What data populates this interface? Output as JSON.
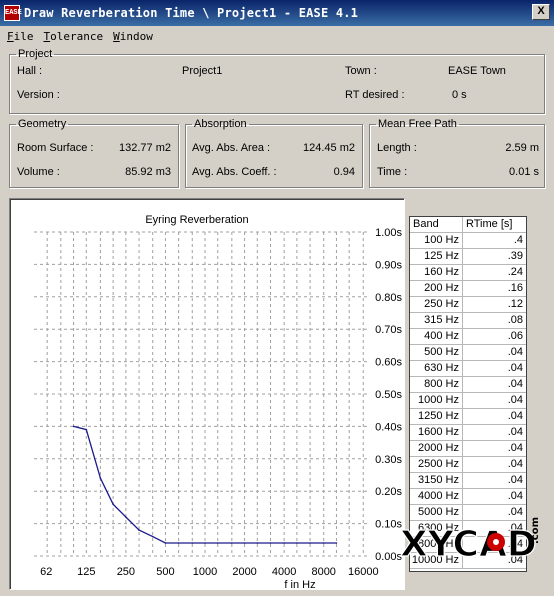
{
  "window": {
    "title": "Draw Reverberation Time \\ Project1 - EASE 4.1",
    "app_icon_text": "EASE",
    "close_label": "X"
  },
  "menu": [
    {
      "label": "File",
      "accel": "F",
      "rest": "ile"
    },
    {
      "label": "Tolerance",
      "accel": "T",
      "rest": "olerance"
    },
    {
      "label": "Window",
      "accel": "W",
      "rest": "indow"
    }
  ],
  "project": {
    "legend": "Project",
    "hall_label": "Hall :",
    "hall_value": "Project1",
    "town_label": "Town :",
    "town_value": "EASE Town",
    "version_label": "Version :",
    "rt_desired_label": "RT desired :",
    "rt_desired_value": "0 s"
  },
  "geometry": {
    "legend": "Geometry",
    "surface_label": "Room Surface :",
    "surface_value": "132.77 m2",
    "volume_label": "Volume :",
    "volume_value": "85.92 m3"
  },
  "absorption": {
    "legend": "Absorption",
    "area_label": "Avg. Abs. Area :",
    "area_value": "124.45 m2",
    "coeff_label": "Avg. Abs. Coeff. :",
    "coeff_value": "0.94"
  },
  "mean_free_path": {
    "legend": "Mean Free Path",
    "length_label": "Length :",
    "length_value": "2.59 m",
    "time_label": "Time :",
    "time_value": "0.01 s"
  },
  "chart_data": {
    "type": "line",
    "title": "Eyring Reverberation",
    "xlabel": "f in Hz",
    "ylabel": "",
    "x_scale": "log",
    "x_ticks": [
      "62",
      "125",
      "250",
      "500",
      "1000",
      "2000",
      "4000",
      "8000",
      "16000"
    ],
    "y_ticks": [
      "0.00s",
      "0.10s",
      "0.20s",
      "0.30s",
      "0.40s",
      "0.50s",
      "0.60s",
      "0.70s",
      "0.80s",
      "0.90s",
      "1.00s"
    ],
    "ylim": [
      0,
      1.0
    ],
    "grid": true,
    "x": [
      100,
      125,
      160,
      200,
      250,
      315,
      400,
      500,
      630,
      800,
      1000,
      1250,
      1600,
      2000,
      2500,
      3150,
      4000,
      5000,
      6300,
      8000,
      10000
    ],
    "series": [
      {
        "values": [
          0.4,
          0.39,
          0.24,
          0.16,
          0.12,
          0.08,
          0.06,
          0.04,
          0.04,
          0.04,
          0.04,
          0.04,
          0.04,
          0.04,
          0.04,
          0.04,
          0.04,
          0.04,
          0.04,
          0.04,
          0.04
        ],
        "color": "#1a1a8c"
      }
    ]
  },
  "rt_table": {
    "col_band": "Band",
    "col_rtime": "RTime [s]",
    "rows": [
      {
        "band": "100 Hz",
        "rtime": ".4"
      },
      {
        "band": "125 Hz",
        "rtime": ".39"
      },
      {
        "band": "160 Hz",
        "rtime": ".24"
      },
      {
        "band": "200 Hz",
        "rtime": ".16"
      },
      {
        "band": "250 Hz",
        "rtime": ".12"
      },
      {
        "band": "315 Hz",
        "rtime": ".08"
      },
      {
        "band": "400 Hz",
        "rtime": ".06"
      },
      {
        "band": "500 Hz",
        "rtime": ".04"
      },
      {
        "band": "630 Hz",
        "rtime": ".04"
      },
      {
        "band": "800 Hz",
        "rtime": ".04"
      },
      {
        "band": "1000 Hz",
        "rtime": ".04"
      },
      {
        "band": "1250 Hz",
        "rtime": ".04"
      },
      {
        "band": "1600 Hz",
        "rtime": ".04"
      },
      {
        "band": "2000 Hz",
        "rtime": ".04"
      },
      {
        "band": "2500 Hz",
        "rtime": ".04"
      },
      {
        "band": "3150 Hz",
        "rtime": ".04"
      },
      {
        "band": "4000 Hz",
        "rtime": ".04"
      },
      {
        "band": "5000 Hz",
        "rtime": ".04"
      },
      {
        "band": "6300 Hz",
        "rtime": ".04"
      },
      {
        "band": "8000 Hz",
        "rtime": ".04"
      },
      {
        "band": "10000 Hz",
        "rtime": ".04"
      }
    ]
  },
  "watermark": {
    "text": "XYCAD",
    "suffix": ".com"
  }
}
